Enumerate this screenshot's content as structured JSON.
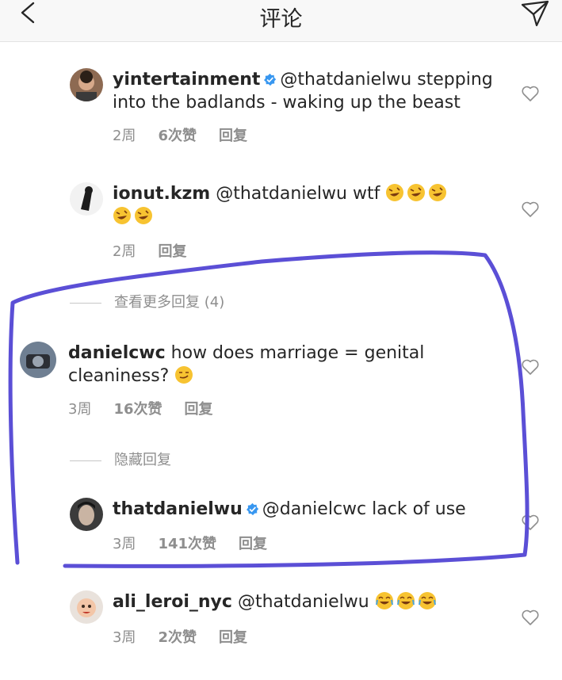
{
  "header": {
    "title": "评论",
    "back_icon": "chevron-left-icon",
    "share_icon": "paper-plane-icon"
  },
  "comments": [
    {
      "username": "yintertainment",
      "verified": true,
      "mention": "@thatdanielwu",
      "text": "stepping into the badlands - waking up the beast",
      "time": "2周",
      "likes": "6次赞",
      "reply": "回复"
    },
    {
      "username": "ionut.kzm",
      "verified": false,
      "mention": "@thatdanielwu",
      "text": "wtf",
      "emojis": [
        "rofl-emoji",
        "rofl-emoji",
        "rofl-emoji",
        "rofl-emoji",
        "rofl-emoji"
      ],
      "time": "2周",
      "reply": "回复"
    },
    {
      "username": "danielcwc",
      "verified": false,
      "text": "how does marriage = genital cleaniness?",
      "emojis": [
        "smirk-emoji"
      ],
      "time": "3周",
      "likes": "16次赞",
      "reply": "回复"
    },
    {
      "username": "thatdanielwu",
      "verified": true,
      "mention": "@danielcwc",
      "text": "lack of use",
      "time": "3周",
      "likes": "141次赞",
      "reply": "回复"
    },
    {
      "username": "ali_leroi_nyc",
      "verified": false,
      "mention": "@thatdanielwu",
      "emojis": [
        "joy-emoji",
        "joy-emoji",
        "joy-emoji"
      ],
      "time": "3周",
      "likes": "2次赞",
      "reply": "回复"
    }
  ],
  "threads": {
    "view_more": "查看更多回复 (4)",
    "hide": "隐藏回复"
  },
  "colors": {
    "text": "#262626",
    "meta": "#8e8e8e",
    "verified": "#3897f0",
    "highlight": "#5b4fd6"
  }
}
